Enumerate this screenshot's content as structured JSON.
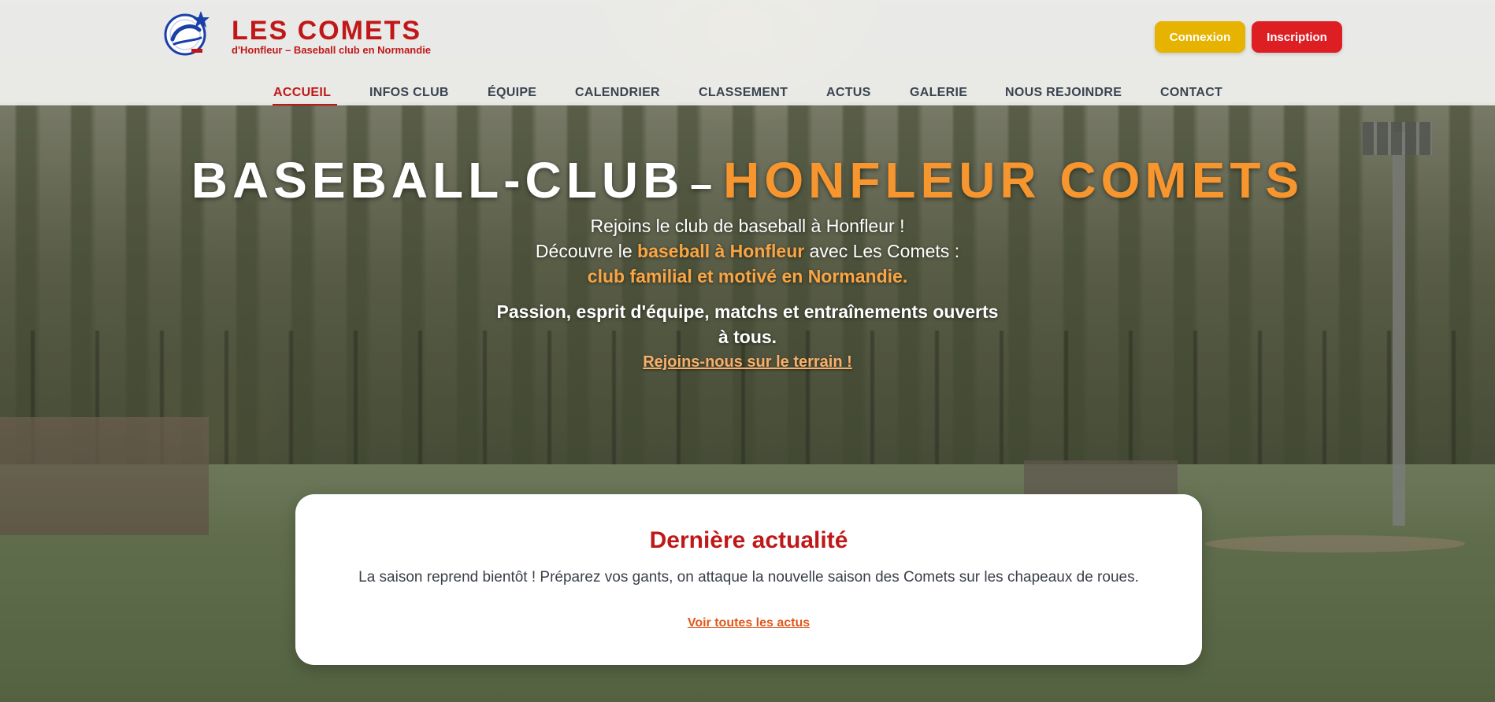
{
  "brand": {
    "logo_icon": "comets-logo-icon",
    "title": "LES COMETS",
    "subtitle": "d'Honfleur – Baseball club en Normandie"
  },
  "auth": {
    "login_label": "Connexion",
    "signup_label": "Inscription"
  },
  "nav": {
    "items": [
      {
        "label": "ACCUEIL",
        "active": true
      },
      {
        "label": "INFOS CLUB",
        "active": false
      },
      {
        "label": "ÉQUIPE",
        "active": false
      },
      {
        "label": "CALENDRIER",
        "active": false
      },
      {
        "label": "CLASSEMENT",
        "active": false
      },
      {
        "label": "ACTUS",
        "active": false
      },
      {
        "label": "GALERIE",
        "active": false
      },
      {
        "label": "NOUS REJOINDRE",
        "active": false
      },
      {
        "label": "CONTACT",
        "active": false
      }
    ]
  },
  "hero": {
    "title_white": "BASEBALL-CLUB",
    "title_dash": "–",
    "title_orange": "HONFLEUR COMETS",
    "line1": "Rejoins le club de baseball à Honfleur !",
    "line2_before": "Découvre le ",
    "line2_highlight": "baseball à Honfleur",
    "line2_after": " avec Les Comets :",
    "line3": "club familial et motivé en Normandie.",
    "strong_line1": "Passion, esprit d'équipe, matchs et entraînements ouverts",
    "strong_line2": "à tous.",
    "cta": "Rejoins-nous sur le terrain !"
  },
  "news": {
    "title": "Dernière actualité",
    "text": "La saison reprend bientôt ! Préparez vos gants, on attaque la nouvelle saison des Comets sur les chapeaux de roues.",
    "link": "Voir toutes les actus"
  },
  "colors": {
    "brand_red": "#c01818",
    "accent_orange": "#f7952e",
    "login_yellow": "#e6b300",
    "signup_red": "#dd1f24"
  }
}
